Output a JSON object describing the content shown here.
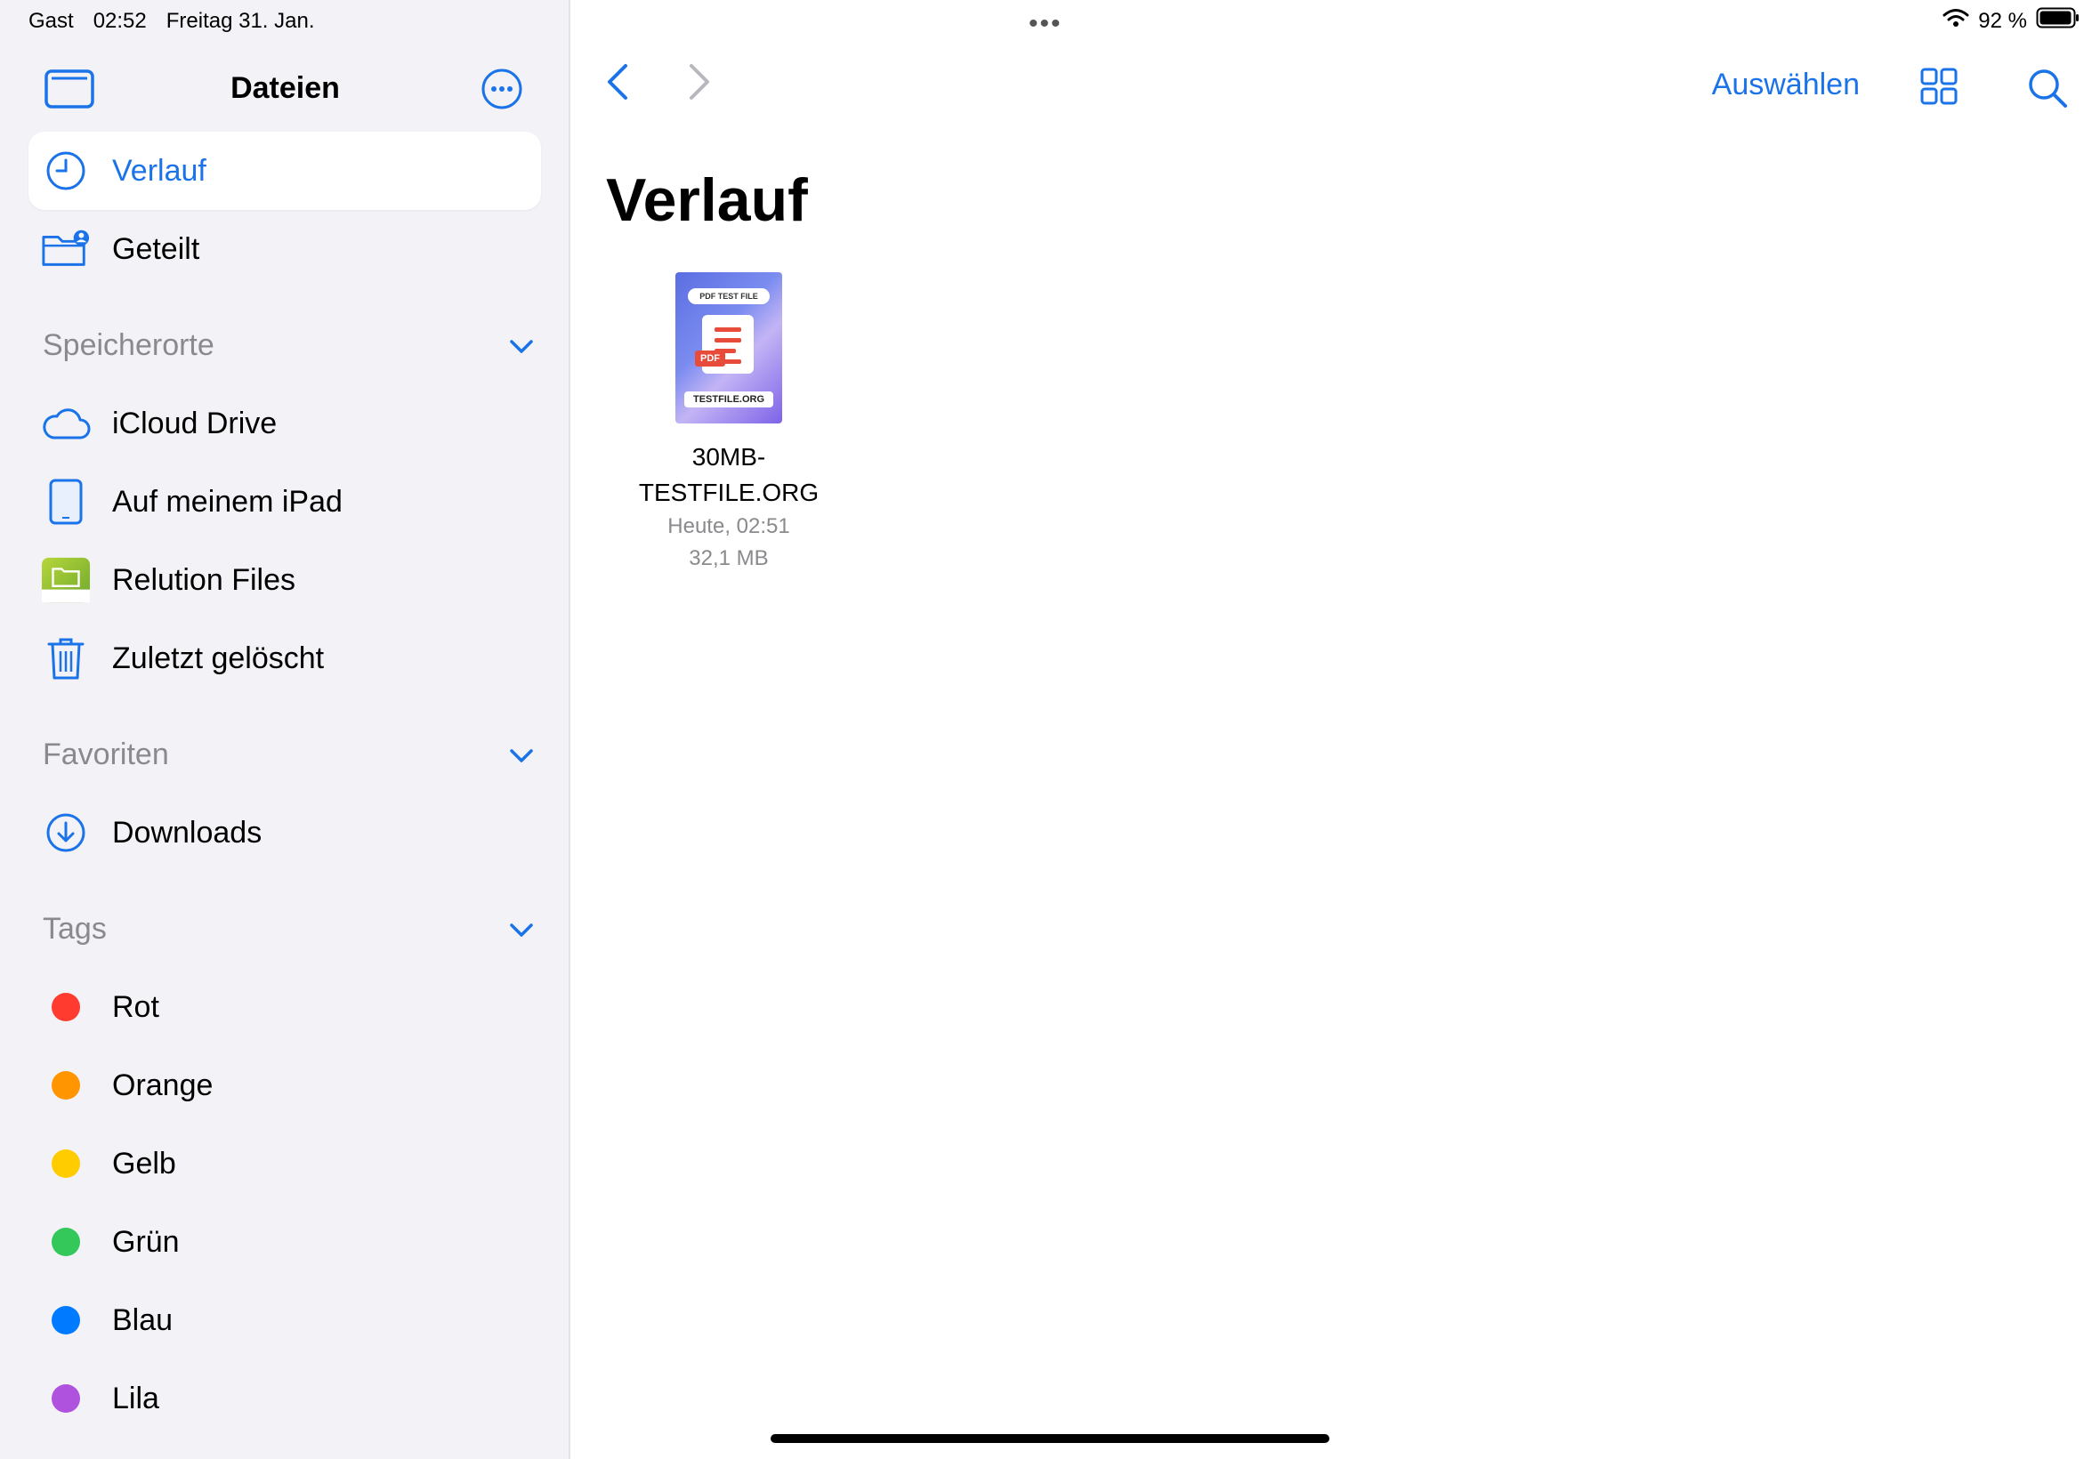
{
  "status": {
    "user": "Gast",
    "time": "02:52",
    "date": "Freitag 31. Jan.",
    "battery": "92 %",
    "multitask": "•••"
  },
  "sidebar": {
    "title": "Dateien",
    "top_items": [
      {
        "label": "Verlauf",
        "icon": "clock-icon",
        "selected": true
      },
      {
        "label": "Geteilt",
        "icon": "shared-folder-icon"
      }
    ],
    "locations_header": "Speicherorte",
    "locations": [
      {
        "label": "iCloud Drive",
        "icon": "cloud-icon"
      },
      {
        "label": "Auf meinem iPad",
        "icon": "ipad-icon"
      },
      {
        "label": "Relution Files",
        "icon": "relution-app-icon"
      },
      {
        "label": "Zuletzt gelöscht",
        "icon": "trash-icon"
      }
    ],
    "favorites_header": "Favoriten",
    "favorites": [
      {
        "label": "Downloads",
        "icon": "download-icon"
      }
    ],
    "tags_header": "Tags",
    "tags": [
      {
        "label": "Rot",
        "color": "#ff3b30"
      },
      {
        "label": "Orange",
        "color": "#ff9500"
      },
      {
        "label": "Gelb",
        "color": "#ffcc00"
      },
      {
        "label": "Grün",
        "color": "#34c759"
      },
      {
        "label": "Blau",
        "color": "#007aff"
      },
      {
        "label": "Lila",
        "color": "#af52de"
      }
    ]
  },
  "toolbar": {
    "select_label": "Auswählen"
  },
  "main": {
    "title": "Verlauf",
    "files": [
      {
        "name_line1": "30MB-",
        "name_line2": "TESTFILE.ORG",
        "date": "Heute, 02:51",
        "size": "32,1 MB",
        "thumb_tag": "PDF TEST FILE",
        "thumb_badge": "PDF",
        "thumb_footer": "TESTFILE.ORG"
      }
    ]
  },
  "colors": {
    "accent": "#1a73e8",
    "sidebar_bg": "#f2f2f7",
    "secondary_text": "#8a8a8e"
  }
}
